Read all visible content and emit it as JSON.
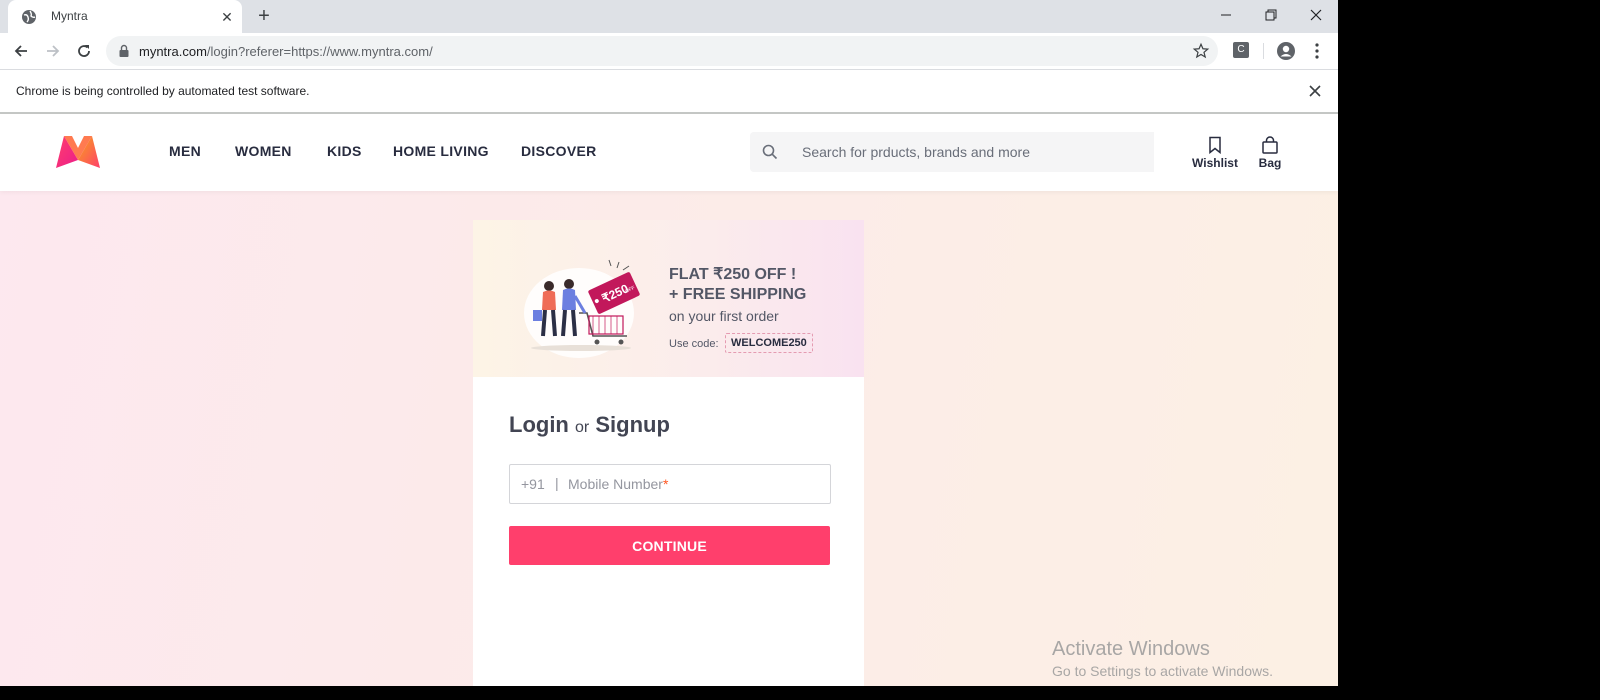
{
  "browser": {
    "tab_title": "Myntra",
    "url_host": "myntra.com",
    "url_path": "/login?referer=https://www.myntra.com/",
    "extension_label": "C",
    "infobar_message": "Chrome is being controlled by automated test software."
  },
  "header": {
    "nav": [
      "MEN",
      "WOMEN",
      "KIDS",
      "HOME LIVING",
      "DISCOVER"
    ],
    "search_placeholder": "Search for prducts, brands and more",
    "wishlist_label": "Wishlist",
    "bag_label": "Bag"
  },
  "promo": {
    "line1": "FLAT ₹250 OFF !",
    "line2": "+ FREE SHIPPING",
    "line3": "on your first order",
    "use_code_label": "Use code:",
    "code": "WELCOME250",
    "tag_text": "₹250",
    "tag_small": "OFF"
  },
  "login": {
    "title_login": "Login",
    "title_or": "or",
    "title_signup": "Signup",
    "country_code": "+91",
    "divider": "|",
    "mobile_placeholder": "Mobile Number",
    "required_mark": "*",
    "continue_label": "CONTINUE"
  },
  "watermark": {
    "title": "Activate Windows",
    "subtitle": "Go to Settings to activate Windows."
  },
  "colors": {
    "accent": "#ff3f6c",
    "text_dark": "#282c3f"
  }
}
